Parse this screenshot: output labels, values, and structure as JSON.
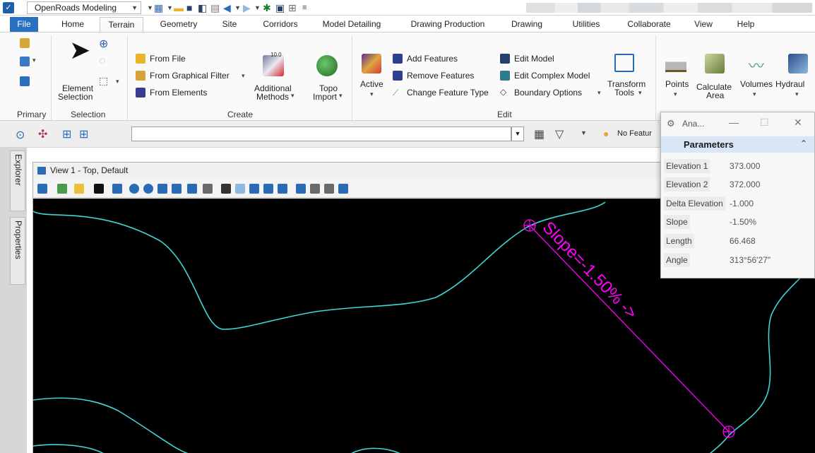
{
  "titlebar": {
    "workspace": "OpenRoads Modeling"
  },
  "tabs": [
    "File",
    "Home",
    "Terrain",
    "Geometry",
    "Site",
    "Corridors",
    "Model Detailing",
    "Drawing Production",
    "Drawing",
    "Utilities",
    "Collaborate",
    "View",
    "Help"
  ],
  "ribbon": {
    "primary": {
      "label": "Primary"
    },
    "selection": {
      "label": "Selection",
      "element_selection_1": "Element",
      "element_selection_2": "Selection"
    },
    "create": {
      "label": "Create",
      "from_file": "From File",
      "from_graphical_filter": "From Graphical Filter",
      "from_elements": "From Elements",
      "additional_methods_1": "Additional",
      "additional_methods_2": "Methods",
      "topo_import_1": "Topo",
      "topo_import_2": "Import",
      "additional_badge": "10.0"
    },
    "edit": {
      "label": "Edit",
      "active": "Active",
      "add_features": "Add Features",
      "remove_features": "Remove Features",
      "change_feature_type": "Change Feature Type",
      "edit_model": "Edit Model",
      "edit_complex_model": "Edit Complex Model",
      "boundary_options": "Boundary Options",
      "transform_tools_1": "Transform",
      "transform_tools_2": "Tools"
    },
    "analysis": {
      "points": "Points",
      "calculate_area_1": "Calculate",
      "calculate_area_2": "Area",
      "volumes": "Volumes",
      "hydraulics": "Hydraul"
    }
  },
  "toolbar2": {
    "command_value": "",
    "no_feature": "No Featur"
  },
  "dock": {
    "explorer": "Explorer",
    "properties": "Properties"
  },
  "view": {
    "title": "View 1 - Top, Default",
    "annotation": "Slope=-1.50% ->",
    "line_color": "#ff00ff",
    "contour_color": "#3fd6d6"
  },
  "analysis_panel": {
    "title": "Ana...",
    "section": "Parameters",
    "params": [
      {
        "label": "Elevation 1",
        "value": "373.000"
      },
      {
        "label": "Elevation 2",
        "value": "372.000"
      },
      {
        "label": "Delta Elevation",
        "value": "-1.000"
      },
      {
        "label": "Slope",
        "value": "-1.50%"
      },
      {
        "label": "Length",
        "value": "66.468"
      },
      {
        "label": "Angle",
        "value": "313°56'27\""
      }
    ]
  }
}
